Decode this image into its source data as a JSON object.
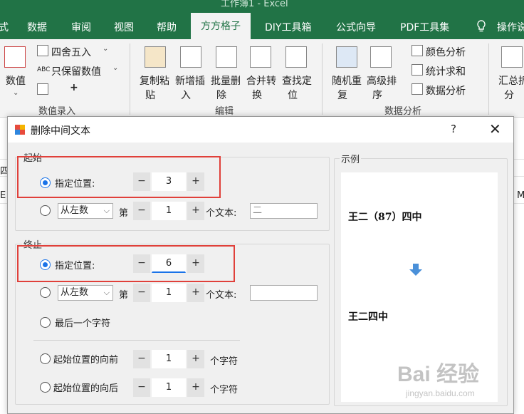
{
  "ribbon_tabs": [
    "式",
    "数据",
    "审阅",
    "视图",
    "帮助",
    "方方格子",
    "DIY工具箱",
    "公式向导",
    "PDF工具集",
    "操作说"
  ],
  "window_title_partial": "工作簿1 - Excel",
  "ribbon": {
    "numeric": "数值",
    "round": "四舍五入",
    "keep_value": "只保留数值",
    "abc": "ABC",
    "group_entry": "数值录入",
    "copy_paste": [
      "复制粘",
      "贴"
    ],
    "new_insert": [
      "新增插",
      "入"
    ],
    "batch_delete": [
      "批量删",
      "除"
    ],
    "merge_convert": [
      "合并转",
      "换"
    ],
    "find_locate": [
      "查找定",
      "位"
    ],
    "group_edit": "编辑",
    "random_repeat": [
      "随机重",
      "复"
    ],
    "advanced_sort": [
      "高级排",
      "序"
    ],
    "color_analysis": "颜色分析",
    "stat_sum": "统计求和",
    "data_analysis": "数据分析",
    "group_data": "数据分析",
    "summary": [
      "汇总拆",
      "分"
    ]
  },
  "sheet": {
    "cell_si": "四",
    "cell_e": "E",
    "cell_m": "M"
  },
  "dialog": {
    "title": "删除中间文本",
    "help": "?",
    "close": "✕",
    "start_group": "起始",
    "end_group": "终止",
    "example_group": "示例",
    "start": {
      "opt1_label": "指定位置:",
      "opt1_value": "3",
      "opt2_dropdown": "从左数",
      "opt2_di": "第",
      "opt2_value": "1",
      "opt2_suffix": "个文本:",
      "opt2_text": "二"
    },
    "end": {
      "opt1_label": "指定位置:",
      "opt1_value": "6",
      "opt2_dropdown": "从左数",
      "opt2_di": "第",
      "opt2_value": "1",
      "opt2_suffix": "个文本:",
      "opt2_text": "",
      "opt3_label": "最后一个字符",
      "opt4_label": "起始位置的向前",
      "opt4_value": "1",
      "opt4_suffix": "个字符",
      "opt5_label": "起始位置的向后",
      "opt5_value": "1",
      "opt5_suffix": "个字符"
    },
    "stepper_minus": "−",
    "stepper_plus": "+",
    "example": {
      "before": "王二（87）四中",
      "after": "王二四中"
    }
  },
  "watermark": {
    "brand": "Bai 经验",
    "url": "jingyan.baidu.com"
  },
  "colors": {
    "excel_green": "#217346",
    "radio_blue": "#1a73e8",
    "highlight_red": "#e0403a",
    "arrow_blue": "#4a90d9"
  }
}
